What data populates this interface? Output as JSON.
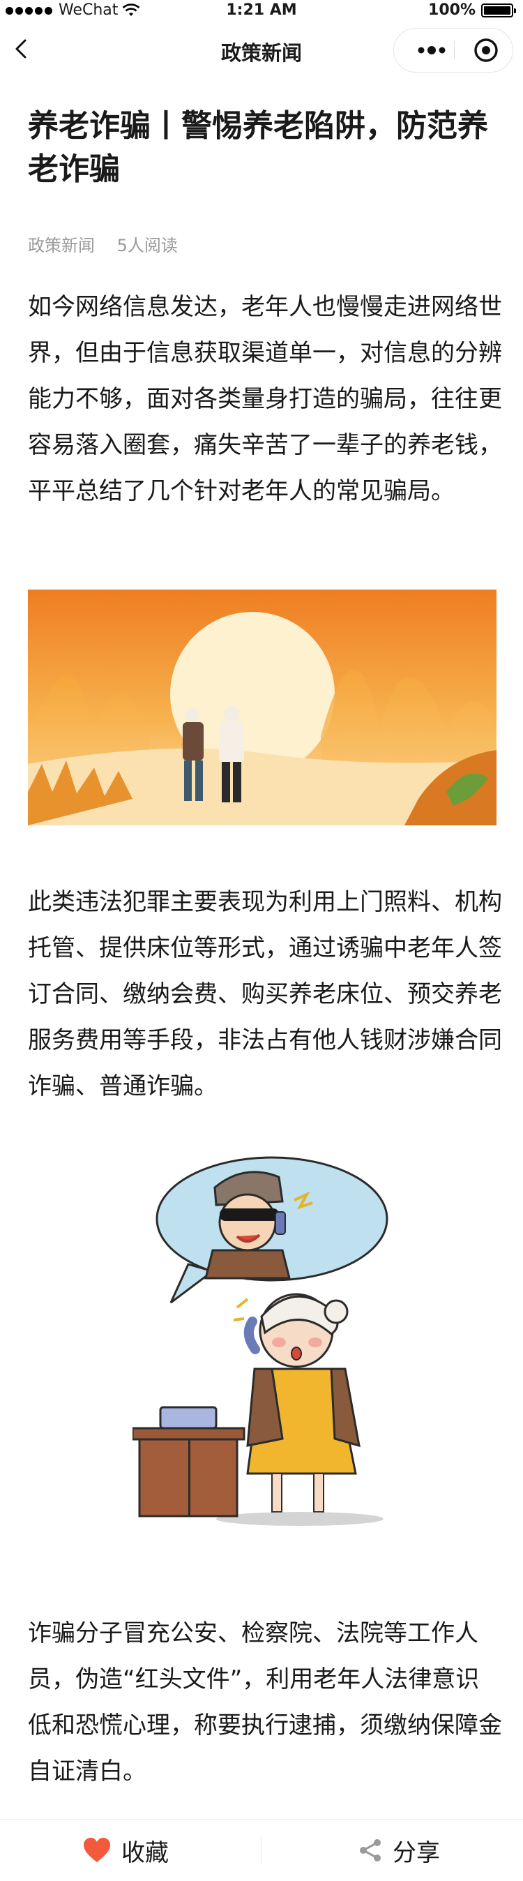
{
  "status_bar": {
    "carrier": "WeChat",
    "time": "1:21 AM",
    "battery": "100%"
  },
  "nav": {
    "title": "政策新闻"
  },
  "article": {
    "title": "养老诈骗丨警惕养老陷阱，防范养老诈骗",
    "source": "政策新闻",
    "reads": "5人阅读",
    "paragraphs": [
      "如今网络信息发达，老年人也慢慢走进网络世界，但由于信息获取渠道单一，对信息的分辨能力不够，面对各类量身打造的骗局，往往更容易落入圈套，痛失辛苦了一辈子的养老钱，平平总结了几个针对老年人的常见骗局。",
      "此类违法犯罪主要表现为利用上门照料、机构托管、提供床位等形式，通过诱骗中老年人签订合同、缴纳会费、购买养老床位、预交养老服务费用等手段，非法占有他人钱财涉嫌合同诈骗、普通诈骗。",
      "诈骗分子冒充公安、检察院、法院等工作人员，伪造“红头文件”，利用老年人法律意识低和恐慌心理，称要执行逮捕，须缴纳保障金自证清白。"
    ]
  },
  "bottom_bar": {
    "favorite_label": "收藏",
    "share_label": "分享"
  },
  "colors": {
    "heart": "#f25a3c",
    "sunset_top": "#f07a1e",
    "sunset_bottom": "#fde3a8"
  }
}
